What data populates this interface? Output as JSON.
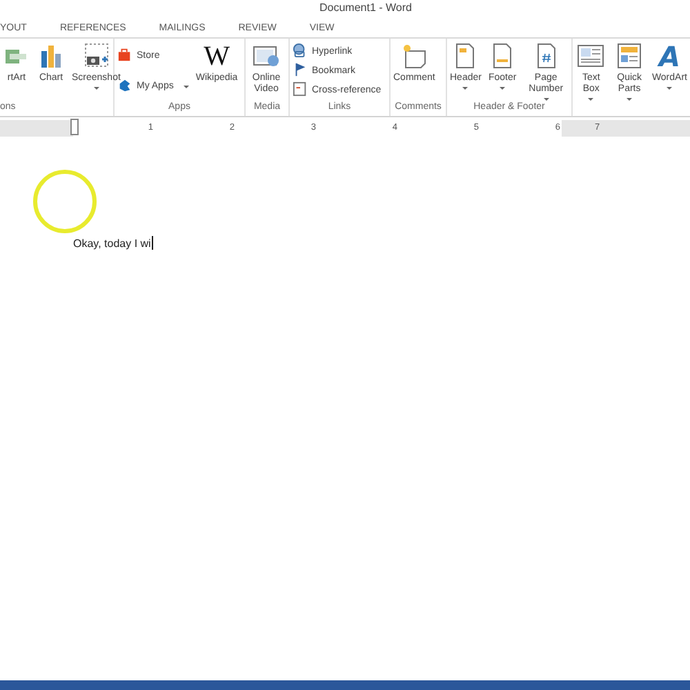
{
  "window": {
    "title": "Document1 - Word"
  },
  "tabs": [
    {
      "label": "YOUT"
    },
    {
      "label": "REFERENCES"
    },
    {
      "label": "MAILINGS"
    },
    {
      "label": "REVIEW"
    },
    {
      "label": "VIEW"
    }
  ],
  "groups": [
    {
      "label": "ons",
      "items": [
        {
          "kind": "large",
          "label": "rtArt",
          "dropdown": false
        },
        {
          "kind": "large",
          "label": "Chart",
          "dropdown": false
        },
        {
          "kind": "large",
          "label": "Screenshot",
          "dropdown": true
        }
      ]
    },
    {
      "label": "Apps",
      "items": [
        {
          "kind": "small",
          "label": "Store",
          "dropdown": false
        },
        {
          "kind": "small",
          "label": "My Apps",
          "dropdown": true
        },
        {
          "kind": "large",
          "label": "Wikipedia",
          "dropdown": false,
          "icon_text": "W"
        }
      ]
    },
    {
      "label": "Media",
      "items": [
        {
          "kind": "large",
          "label": "Online Video",
          "dropdown": false
        }
      ]
    },
    {
      "label": "Links",
      "items": [
        {
          "kind": "small",
          "label": "Hyperlink",
          "dropdown": false
        },
        {
          "kind": "small",
          "label": "Bookmark",
          "dropdown": false
        },
        {
          "kind": "small",
          "label": "Cross-reference",
          "dropdown": false
        }
      ]
    },
    {
      "label": "Comments",
      "items": [
        {
          "kind": "large",
          "label": "Comment",
          "dropdown": false
        }
      ]
    },
    {
      "label": "Header & Footer",
      "items": [
        {
          "kind": "large",
          "label": "Header",
          "dropdown": true
        },
        {
          "kind": "large",
          "label": "Footer",
          "dropdown": true
        },
        {
          "kind": "large",
          "label": "Page Number",
          "dropdown": true
        }
      ]
    },
    {
      "items": [
        {
          "kind": "large",
          "label": "Text Box",
          "dropdown": true
        },
        {
          "kind": "large",
          "label": "Quick Parts",
          "dropdown": true
        },
        {
          "kind": "large",
          "label": "WordArt",
          "dropdown": true,
          "icon_text": "A"
        }
      ]
    }
  ],
  "ruler": [
    "1",
    "2",
    "3",
    "4",
    "5",
    "6",
    "7"
  ],
  "document": {
    "text": "Okay, today I wi"
  }
}
